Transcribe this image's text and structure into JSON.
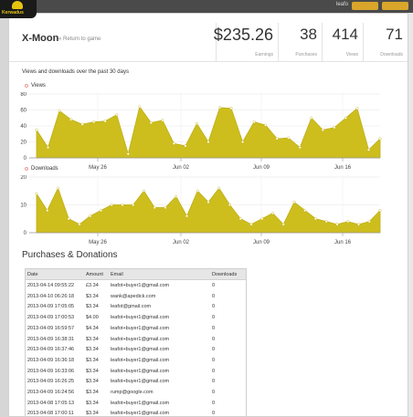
{
  "topbar": {
    "user": "leafo",
    "logo_text": "Kerwadus"
  },
  "header": {
    "title": "X-Moon",
    "back_link": "« Return to game",
    "stats": [
      {
        "value": "$235.26",
        "label": "Earnings"
      },
      {
        "value": "38",
        "label": "Purchases"
      },
      {
        "value": "414",
        "label": "Views"
      },
      {
        "value": "71",
        "label": "Downloads"
      }
    ]
  },
  "section_caption": "Views and downloads over the past 30 days",
  "chart_data": [
    {
      "type": "area",
      "series": [
        {
          "name": "Views",
          "values": [
            35,
            13,
            59,
            48,
            42,
            45,
            46,
            54,
            5,
            64,
            44,
            47,
            18,
            15,
            43,
            20,
            63,
            62,
            20,
            45,
            41,
            24,
            25,
            13,
            50,
            35,
            38,
            50,
            62,
            10,
            24
          ]
        }
      ],
      "ylim": [
        0,
        80
      ],
      "yticks": [
        0,
        20,
        40,
        60,
        80
      ],
      "xticks": [
        "May 26",
        "Jun 02",
        "Jun 09",
        "Jun 16"
      ],
      "color": "#cdbe1e"
    },
    {
      "type": "area",
      "series": [
        {
          "name": "Downloads",
          "values": [
            14,
            8,
            16,
            5,
            3,
            6,
            8,
            10,
            10,
            10,
            15,
            9,
            9,
            13,
            6,
            15,
            11,
            16,
            10,
            5,
            3,
            5,
            7,
            3,
            11,
            8,
            5,
            4,
            3,
            4,
            3,
            4,
            8
          ]
        }
      ],
      "ylim": [
        0,
        20
      ],
      "yticks": [
        0,
        10,
        20
      ],
      "xticks": [
        "May 26",
        "Jun 02",
        "Jun 09",
        "Jun 16"
      ],
      "color": "#cdbe1e"
    }
  ],
  "purchases": {
    "title": "Purchases & Donations",
    "columns": [
      "Date",
      "Amount",
      "Email",
      "Downloads"
    ],
    "rows": [
      [
        "2013-04-14 09:55:22",
        "£3.34",
        "leafot+buyer1@gmail.com",
        "0"
      ],
      [
        "2013-04-10 06:26:18",
        "$3.34",
        "wank@apedick.com",
        "0"
      ],
      [
        "2013-04-09 17:05:05",
        "$3.34",
        "leafot@gmail.com",
        "0"
      ],
      [
        "2013-04-09 17:00:53",
        "$4.00",
        "leafot+buyer1@gmail.com",
        "0"
      ],
      [
        "2013-04-09 16:59:57",
        "$4.34",
        "leafot+buyer1@gmail.com",
        "0"
      ],
      [
        "2013-04-09 16:38:31",
        "$3.34",
        "leafot+buyer1@gmail.com",
        "0"
      ],
      [
        "2013-04-09 16:37:46",
        "$3.34",
        "leafot+buyer1@gmail.com",
        "0"
      ],
      [
        "2013-04-09 16:36:18",
        "$3.34",
        "leafot+buyer1@gmail.com",
        "0"
      ],
      [
        "2013-04-09 16:33:06",
        "$3.34",
        "leafot+buyer1@gmail.com",
        "0"
      ],
      [
        "2013-04-09 16:26:25",
        "$3.34",
        "leafot+buyer1@gmail.com",
        "0"
      ],
      [
        "2013-04-09 16:24:56",
        "$3.34",
        "rump@google.com",
        "0"
      ],
      [
        "2013-04-08 17:05:13",
        "$3.34",
        "leafot+buyer1@gmail.com",
        "0"
      ],
      [
        "2013-04-08 17:00:11",
        "$3.34",
        "leafot+buyer1@gmail.com",
        "0"
      ]
    ]
  }
}
